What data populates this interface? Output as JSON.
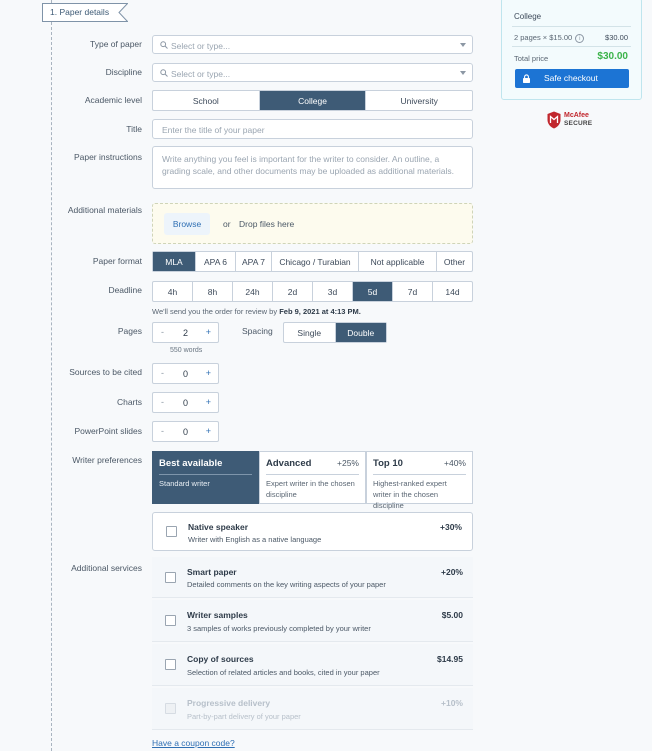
{
  "step": {
    "label": "1.  Paper details"
  },
  "fields": {
    "type_of_paper": {
      "label": "Type of paper",
      "placeholder": "Select or type..."
    },
    "discipline": {
      "label": "Discipline",
      "placeholder": "Select or type..."
    },
    "academic_level": {
      "label": "Academic level",
      "options": [
        "School",
        "College",
        "University"
      ],
      "selected": "College"
    },
    "title": {
      "label": "Title",
      "placeholder": "Enter the title of your paper"
    },
    "instructions": {
      "label": "Paper instructions",
      "placeholder": "Write anything you feel is important for the writer to consider. An outline, a grading scale, and other documents may be uploaded as additional materials."
    },
    "materials": {
      "label": "Additional materials",
      "browse": "Browse",
      "or": "or",
      "drop": "Drop files here"
    },
    "paper_format": {
      "label": "Paper format",
      "options": [
        "MLA",
        "APA 6",
        "APA 7",
        "Chicago / Turabian",
        "Not applicable",
        "Other"
      ],
      "selected": "MLA"
    },
    "deadline": {
      "label": "Deadline",
      "options": [
        "4h",
        "8h",
        "24h",
        "2d",
        "3d",
        "5d",
        "7d",
        "14d"
      ],
      "selected": "5d",
      "note_prefix": "We'll send you the order for review by ",
      "note_date": "Feb 9, 2021 at 4:13 PM."
    },
    "pages": {
      "label": "Pages",
      "value": "2",
      "words": "550 words",
      "minus": "-",
      "plus": "+"
    },
    "spacing": {
      "label": "Spacing",
      "options": [
        "Single",
        "Double"
      ],
      "selected": "Double"
    },
    "sources": {
      "label": "Sources to be cited",
      "value": "0",
      "minus": "-",
      "plus": "+"
    },
    "charts": {
      "label": "Charts",
      "value": "0",
      "minus": "-",
      "plus": "+"
    },
    "slides": {
      "label": "PowerPoint slides",
      "value": "0",
      "minus": "-",
      "plus": "+"
    },
    "writer_preferences": {
      "label": "Writer preferences",
      "options": [
        {
          "title": "Best available",
          "price": "",
          "desc": "Standard writer",
          "selected": true
        },
        {
          "title": "Advanced",
          "price": "+25%",
          "desc": "Expert writer in the chosen discipline",
          "selected": false
        },
        {
          "title": "Top 10",
          "price": "+40%",
          "desc": "Highest-ranked expert writer in the chosen discipline",
          "selected": false
        }
      ]
    },
    "additional_services": {
      "label": "Additional services",
      "items": [
        {
          "name": "Native speaker",
          "desc": "Writer with English as a native language",
          "price": "+30%"
        },
        {
          "name": "Smart paper",
          "desc": "Detailed comments on the key writing aspects of your paper",
          "price": "+20%"
        },
        {
          "name": "Writer samples",
          "desc": "3 samples of works previously completed by your writer",
          "price": "$5.00"
        },
        {
          "name": "Copy of sources",
          "desc": "Selection of related articles and books, cited in your paper",
          "price": "$14.95"
        },
        {
          "name": "Progressive delivery",
          "desc": "Part-by-part delivery of your paper",
          "price": "+10%",
          "disabled": true
        }
      ]
    },
    "coupon": "Have a coupon code?"
  },
  "summary": {
    "level": "College",
    "pages_line": "2 pages × $15.00",
    "info": "i",
    "pages_price": "$30.00",
    "total_label": "Total price",
    "total": "$30.00",
    "checkout": "Safe checkout"
  },
  "badge": {
    "line1": "McAfee",
    "line2": "SECURE"
  },
  "colors": {
    "accent": "#3e5b76",
    "link": "#2f6fb3",
    "checkout": "#1c74d4",
    "total": "#3bb34a",
    "mcafee": "#c1272d"
  }
}
